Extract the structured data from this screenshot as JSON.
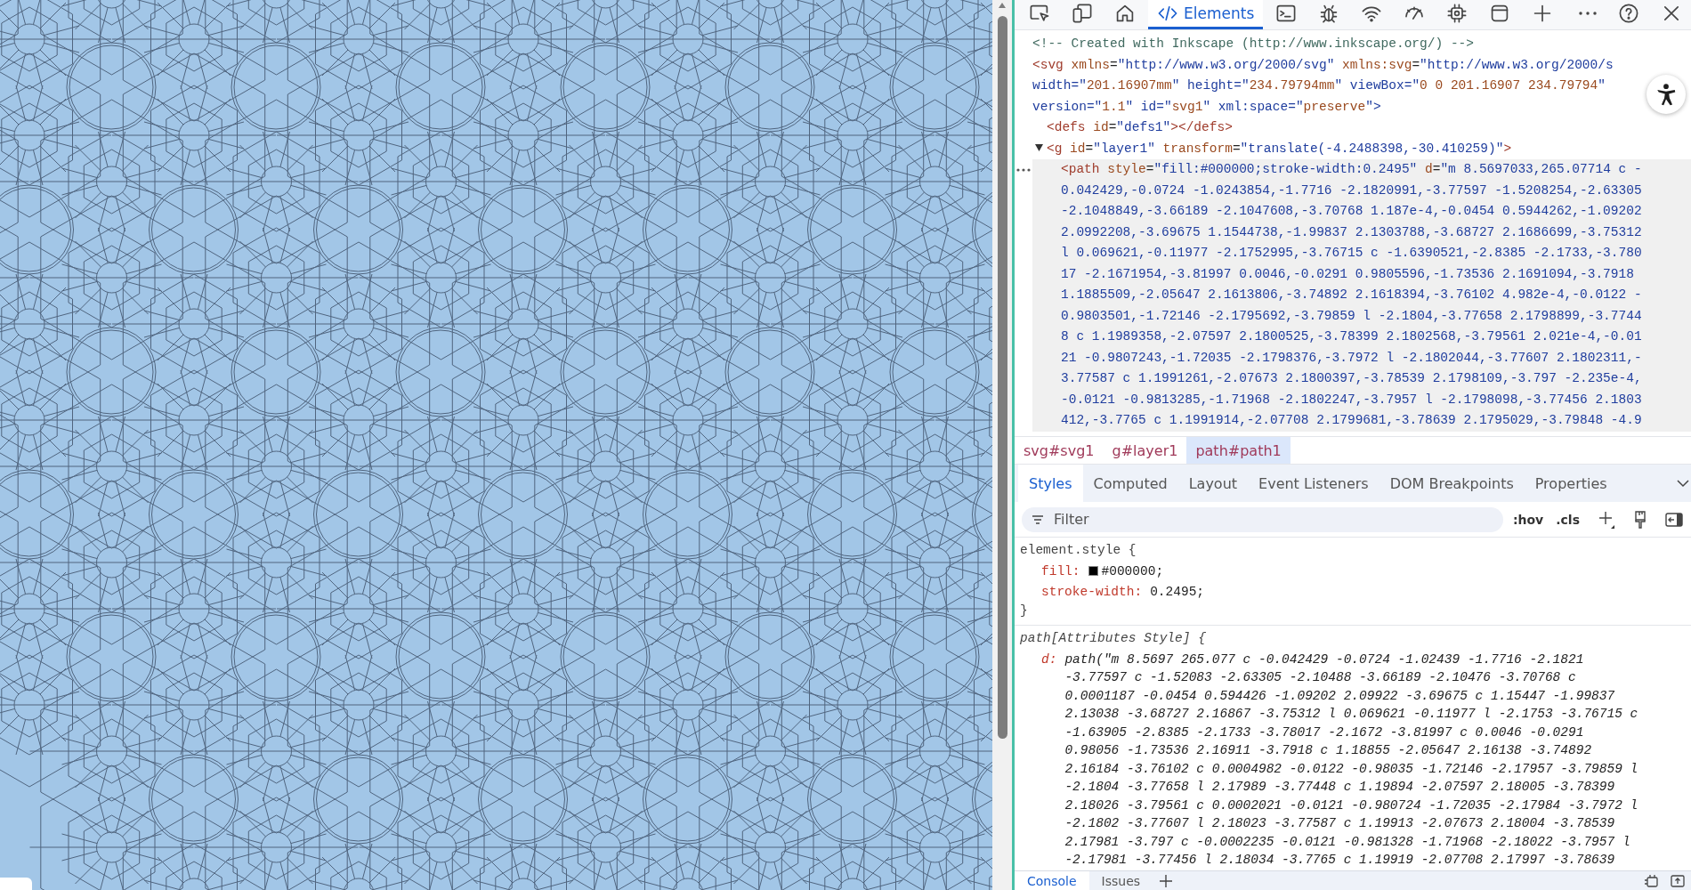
{
  "toolbar": {
    "tabs": [
      {
        "kind": "inspect",
        "selected": false
      },
      {
        "kind": "device",
        "selected": false
      },
      {
        "kind": "home",
        "selected": false
      },
      {
        "kind": "elements",
        "label": "Elements",
        "selected": true
      },
      {
        "kind": "console",
        "selected": false
      },
      {
        "kind": "bug",
        "selected": false
      },
      {
        "kind": "wifi",
        "selected": false
      },
      {
        "kind": "gauge",
        "selected": false
      },
      {
        "kind": "chip",
        "selected": false
      },
      {
        "kind": "window",
        "selected": false
      },
      {
        "kind": "plus",
        "selected": false
      }
    ],
    "actions": [
      {
        "kind": "more"
      },
      {
        "kind": "help"
      },
      {
        "kind": "close"
      }
    ]
  },
  "dom_tree": {
    "nodes": [
      {
        "kind": "comment",
        "selected": false,
        "lines": [
          "<!-- Created with Inkscape (http://www.inkscape.org/) -->"
        ]
      },
      {
        "kind": "tag",
        "selected": false,
        "lines": [
          "<svg xmlns=\"http://www.w3.org/2000/svg\" xmlns:svg=\"http://www.w3.org/2000/s",
          "width=\"201.16907mm\" height=\"234.79794mm\" viewBox=\"0 0 201.16907 234.79794\"",
          "version=\"1.1\" id=\"svg1\" xml:space=\"preserve\">"
        ],
        "children": [
          {
            "kind": "tag",
            "selected": false,
            "lines": [
              "<defs id=\"defs1\"></defs>"
            ]
          },
          {
            "kind": "tag",
            "selected": false,
            "expanded": true,
            "lines": [
              "<g id=\"layer1\" transform=\"translate(-4.2488398,-30.410259)\">"
            ],
            "children": [
              {
                "kind": "tag",
                "selected": true,
                "lines": [
                  "<path style=\"fill:#000000;stroke-width:0.2495\" d=\"m 8.5697033,265.07714 c -",
                  "0.042429,-0.0724 -1.0243854,-1.7716 -2.1820991,-3.77597 -1.5208254,-2.63305",
                  "-2.1048849,-3.66189 -2.1047608,-3.70768 1.187e-4,-0.0454 0.5944262,-1.09202",
                  "2.0992208,-3.69675 1.1544738,-1.99837 2.1303788,-3.68727 2.1686699,-3.75312",
                  "l 0.069621,-0.11977 -2.1752995,-3.76715 c -1.6390521,-2.8385 -2.1733,-3.780",
                  "17 -2.1671954,-3.81997 0.0046,-0.0291 0.9805596,-1.73536 2.1691094,-3.7918",
                  "1.1885509,-2.05647 2.1613806,-3.74892 2.1618394,-3.76102 4.982e-4,-0.0122 -",
                  "0.9803501,-1.72146 -2.1795692,-3.79859 l -2.1804,-3.77658 2.1798899,-3.7744",
                  "8 c 1.1989358,-2.07597 2.1800525,-3.78399 2.1802568,-3.79561 2.021e-4,-0.01",
                  "21 -0.9807243,-1.72035 -2.1798376,-3.7972 l -2.1802044,-3.77607 2.1802311,-",
                  "3.77587 c 1.1991261,-2.07673 2.1800397,-3.78539 2.1798109,-3.797 -2.235e-4,",
                  "-0.0121 -0.9813285,-1.71968 -2.1802247,-3.7957 l -2.1798098,-3.77456 2.1803",
                  "412,-3.7765 c 1.1991914,-2.07708 2.1799681,-3.78639 2.1795029,-3.79848 -4.9"
                ]
              }
            ]
          }
        ]
      }
    ]
  },
  "breadcrumbs": [
    {
      "label": "svg#svg1",
      "selected": false
    },
    {
      "label": "g#layer1",
      "selected": false
    },
    {
      "label": "path#path1",
      "selected": true
    }
  ],
  "sidebar_tabs": [
    {
      "label": "Styles",
      "selected": true
    },
    {
      "label": "Computed",
      "selected": false
    },
    {
      "label": "Layout",
      "selected": false
    },
    {
      "label": "Event Listeners",
      "selected": false
    },
    {
      "label": "DOM Breakpoints",
      "selected": false
    },
    {
      "label": "Properties",
      "selected": false
    }
  ],
  "filter": {
    "placeholder": "Filter",
    "buttons": [
      ":hov",
      ".cls"
    ]
  },
  "rules": [
    {
      "kind": "inline",
      "selector": "element.style {",
      "declarations": [
        {
          "property": "fill:",
          "value_lines": [
            "#000000;"
          ],
          "color": "#000000"
        },
        {
          "property": "stroke-width:",
          "value_lines": [
            "0.2495;"
          ]
        }
      ],
      "close": "}"
    },
    {
      "kind": "attributes",
      "selector": "path[Attributes Style] {",
      "declarations": [
        {
          "property": "d:",
          "value_lines": [
            "path(\"m 8.5697 265.077 c -0.042429 -0.0724 -1.02439 -1.7716 -2.1821",
            "-3.77597 c -1.52083 -2.63305 -2.10488 -3.66189 -2.10476 -3.70768 c",
            "0.0001187 -0.0454 0.594426 -1.09202 2.09922 -3.69675 c 1.15447 -1.99837",
            "2.13038 -3.68727 2.16867 -3.75312 l 0.069621 -0.11977 l -2.1753 -3.76715 c",
            "-1.63905 -2.8385 -2.1733 -3.78017 -2.1672 -3.81997 c 0.0046 -0.0291",
            "0.98056 -1.73536 2.16911 -3.7918 c 1.18855 -2.05647 2.16138 -3.74892",
            "2.16184 -3.76102 c 0.0004982 -0.0122 -0.98035 -1.72146 -2.17957 -3.79859 l",
            "-2.1804 -3.77658 l 2.17989 -3.77448 c 1.19894 -2.07597 2.18005 -3.78399",
            "2.18026 -3.79561 c 0.0002021 -0.0121 -0.980724 -1.72035 -2.17984 -3.7972 l",
            "-2.1802 -3.77607 l 2.18023 -3.77587 c 1.19913 -2.07673 2.18004 -3.78539",
            "2.17981 -3.797 c -0.0002235 -0.0121 -0.981328 -1.71968 -2.18022 -3.7957 l",
            "-2.17981 -3.77456 l 2.18034 -3.7765 c 1.19919 -2.07708 2.17997 -3.78639"
          ]
        }
      ]
    }
  ],
  "drawer": {
    "tabs": [
      {
        "label": "Console",
        "selected": true
      },
      {
        "label": "Issues",
        "selected": false
      }
    ]
  }
}
